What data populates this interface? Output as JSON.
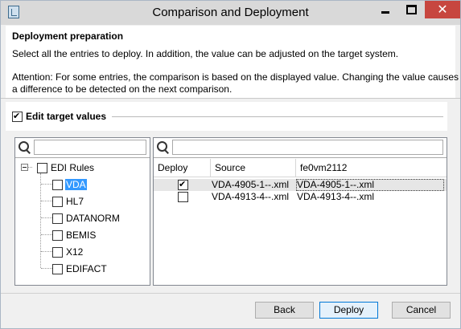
{
  "window": {
    "title": "Comparison and Deployment"
  },
  "header": {
    "title": "Deployment preparation",
    "description": "Select all the entries to deploy. In addition, the value can be adjusted on the target system.",
    "attention_line1": "Attention: For some entries, the comparison is based on the displayed value. Changing the value causes",
    "attention_line2": "a difference to be detected on the next comparison."
  },
  "edit_target": {
    "label": "Edit target values",
    "checked": true
  },
  "tree": {
    "search_value": "",
    "root": {
      "label": "EDI Rules",
      "checked": false,
      "expanded": true
    },
    "items": [
      {
        "label": "VDA",
        "checked": false,
        "selected": true
      },
      {
        "label": "HL7",
        "checked": false
      },
      {
        "label": "DATANORM",
        "checked": false
      },
      {
        "label": "BEMIS",
        "checked": false
      },
      {
        "label": "X12",
        "checked": false
      },
      {
        "label": "EDIFACT",
        "checked": false
      }
    ]
  },
  "table": {
    "search_value": "",
    "columns": [
      "Deploy",
      "Source",
      "fe0vm2112"
    ],
    "rows": [
      {
        "deploy": true,
        "source": "VDA-4905-1--.xml",
        "target": "VDA-4905-1--.xml",
        "selected": true
      },
      {
        "deploy": false,
        "source": "VDA-4913-4--.xml",
        "target": "VDA-4913-4--.xml",
        "selected": false
      }
    ]
  },
  "buttons": {
    "back": "Back",
    "deploy": "Deploy",
    "cancel": "Cancel"
  }
}
